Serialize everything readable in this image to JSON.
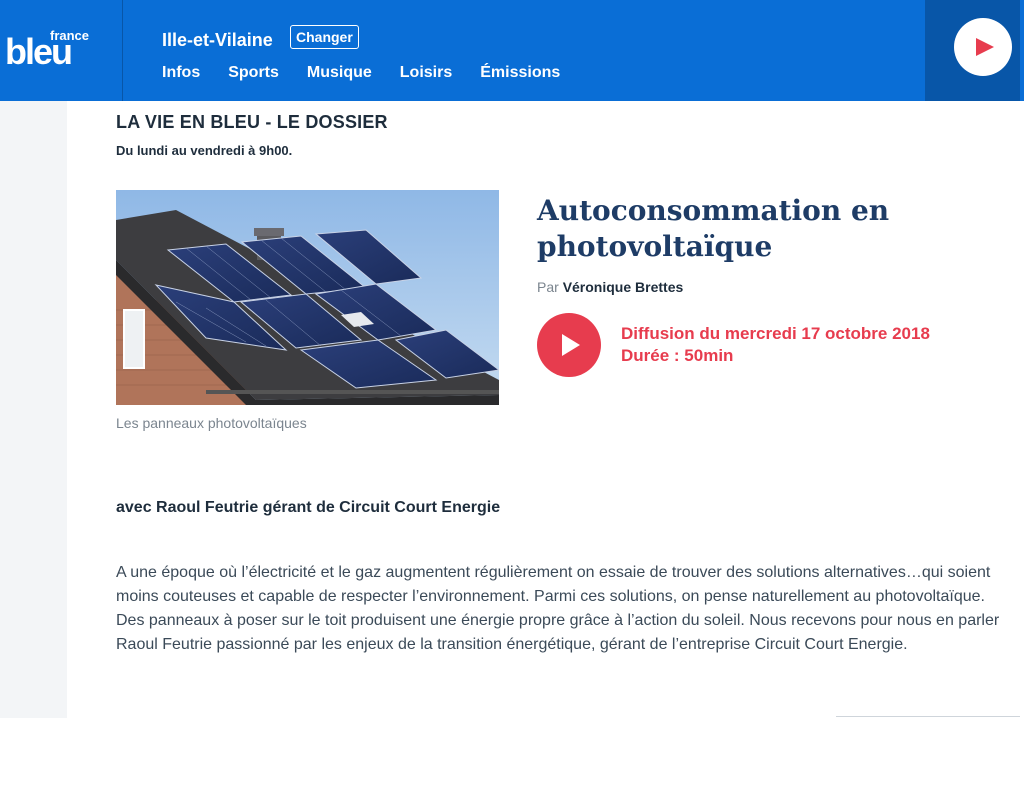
{
  "header": {
    "logo_small": "france",
    "logo_big": "bleu",
    "region": "Ille-et-Vilaine",
    "change_label": "Changer",
    "nav": [
      "Infos",
      "Sports",
      "Musique",
      "Loisirs",
      "Émissions"
    ],
    "play_icon": "play-icon"
  },
  "show": {
    "title": "LA VIE EN BLEU - LE DOSSIER",
    "schedule": "Du lundi au vendredi à 9h00."
  },
  "episode": {
    "title": "Autoconsommation en photovoltaïque",
    "author_prefix": "Par",
    "author": "Véronique Brettes",
    "broadcast": "Diffusion du mercredi 17 octobre 2018",
    "duration": "Durée : 50min",
    "image_caption": "Les panneaux photovoltaïques"
  },
  "article": {
    "guest": "avec Raoul Feutrie gérant de Circuit Court Energie",
    "body": "A une époque où l’électricité et le gaz augmentent régulièrement on essaie de trouver des solutions alternatives…qui soient moins couteuses et capable de respecter l’environnement. Parmi ces solutions, on pense naturellement au photovoltaïque. Des panneaux à poser sur le toit produisent une énergie propre grâce à l’action du soleil. Nous recevons pour nous en parler Raoul Feutrie passionné par les enjeux de la transition énergétique, gérant de l’entreprise Circuit Court Energie."
  },
  "colors": {
    "brand_blue": "#0a6ed6",
    "accent_red": "#e73c4e",
    "title_navy": "#1e3c66"
  }
}
